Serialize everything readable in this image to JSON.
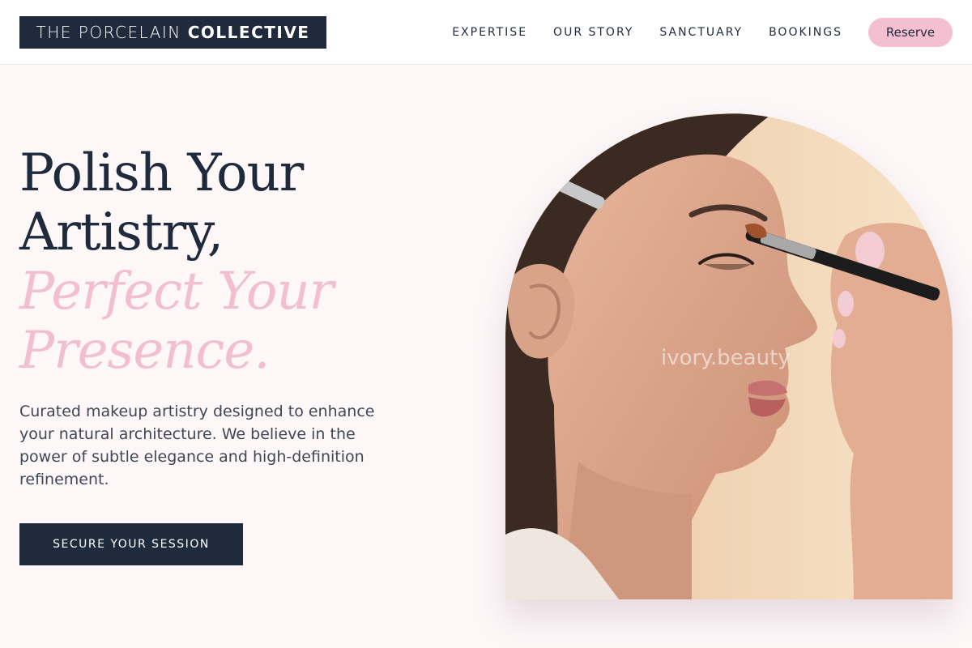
{
  "brand": {
    "name_light": "THE PORCELAIN",
    "name_bold": "COLLECTIVE"
  },
  "nav": {
    "links": [
      "EXPERTISE",
      "OUR STORY",
      "SANCTUARY",
      "BOOKINGS"
    ],
    "reserve_label": "Reserve"
  },
  "hero": {
    "headline_line1": "Polish Your",
    "headline_line2": "Artistry,",
    "headline_line3": "Perfect Your",
    "headline_line4": "Presence.",
    "description": "Curated makeup artistry designed to enhance your natural architecture. We believe in the power of subtle elegance and high-definition refinement.",
    "cta_label": "SECURE YOUR SESSION",
    "image_watermark": "ivory.beauty"
  },
  "colors": {
    "navy": "#1f2a3c",
    "blush_pink": "#f4bfd0",
    "background": "#fdf7f8"
  }
}
